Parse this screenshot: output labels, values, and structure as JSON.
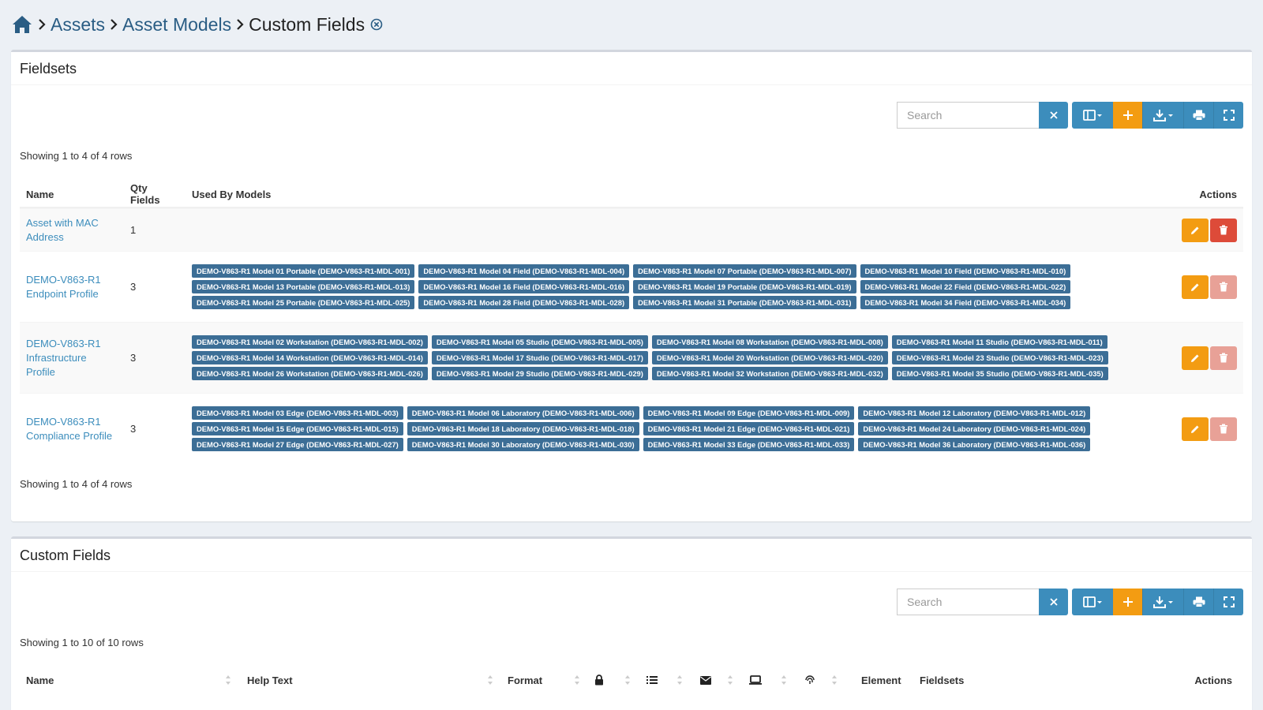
{
  "breadcrumb": {
    "items": [
      "Assets",
      "Asset Models"
    ],
    "current": "Custom Fields"
  },
  "fieldsets": {
    "title": "Fieldsets",
    "search_placeholder": "Search",
    "showing_top": "Showing 1 to 4 of 4 rows",
    "showing_bottom": "Showing 1 to 4 of 4 rows",
    "columns": [
      "Name",
      "Qty Fields",
      "Used By Models",
      "Actions"
    ],
    "rows": [
      {
        "name": "Asset with MAC Address",
        "qty": "1",
        "models": []
      },
      {
        "name": "DEMO-V863-R1 Endpoint Profile",
        "qty": "3",
        "models": [
          "DEMO-V863-R1 Model 01 Portable (DEMO-V863-R1-MDL-001)",
          "DEMO-V863-R1 Model 04 Field (DEMO-V863-R1-MDL-004)",
          "DEMO-V863-R1 Model 07 Portable (DEMO-V863-R1-MDL-007)",
          "DEMO-V863-R1 Model 10 Field (DEMO-V863-R1-MDL-010)",
          "DEMO-V863-R1 Model 13 Portable (DEMO-V863-R1-MDL-013)",
          "DEMO-V863-R1 Model 16 Field (DEMO-V863-R1-MDL-016)",
          "DEMO-V863-R1 Model 19 Portable (DEMO-V863-R1-MDL-019)",
          "DEMO-V863-R1 Model 22 Field (DEMO-V863-R1-MDL-022)",
          "DEMO-V863-R1 Model 25 Portable (DEMO-V863-R1-MDL-025)",
          "DEMO-V863-R1 Model 28 Field (DEMO-V863-R1-MDL-028)",
          "DEMO-V863-R1 Model 31 Portable (DEMO-V863-R1-MDL-031)",
          "DEMO-V863-R1 Model 34 Field (DEMO-V863-R1-MDL-034)"
        ]
      },
      {
        "name": "DEMO-V863-R1 Infrastructure Profile",
        "qty": "3",
        "models": [
          "DEMO-V863-R1 Model 02 Workstation (DEMO-V863-R1-MDL-002)",
          "DEMO-V863-R1 Model 05 Studio (DEMO-V863-R1-MDL-005)",
          "DEMO-V863-R1 Model 08 Workstation (DEMO-V863-R1-MDL-008)",
          "DEMO-V863-R1 Model 11 Studio (DEMO-V863-R1-MDL-011)",
          "DEMO-V863-R1 Model 14 Workstation (DEMO-V863-R1-MDL-014)",
          "DEMO-V863-R1 Model 17 Studio (DEMO-V863-R1-MDL-017)",
          "DEMO-V863-R1 Model 20 Workstation (DEMO-V863-R1-MDL-020)",
          "DEMO-V863-R1 Model 23 Studio (DEMO-V863-R1-MDL-023)",
          "DEMO-V863-R1 Model 26 Workstation (DEMO-V863-R1-MDL-026)",
          "DEMO-V863-R1 Model 29 Studio (DEMO-V863-R1-MDL-029)",
          "DEMO-V863-R1 Model 32 Workstation (DEMO-V863-R1-MDL-032)",
          "DEMO-V863-R1 Model 35 Studio (DEMO-V863-R1-MDL-035)"
        ]
      },
      {
        "name": "DEMO-V863-R1 Compliance Profile",
        "qty": "3",
        "models": [
          "DEMO-V863-R1 Model 03 Edge (DEMO-V863-R1-MDL-003)",
          "DEMO-V863-R1 Model 06 Laboratory (DEMO-V863-R1-MDL-006)",
          "DEMO-V863-R1 Model 09 Edge (DEMO-V863-R1-MDL-009)",
          "DEMO-V863-R1 Model 12 Laboratory (DEMO-V863-R1-MDL-012)",
          "DEMO-V863-R1 Model 15 Edge (DEMO-V863-R1-MDL-015)",
          "DEMO-V863-R1 Model 18 Laboratory (DEMO-V863-R1-MDL-018)",
          "DEMO-V863-R1 Model 21 Edge (DEMO-V863-R1-MDL-021)",
          "DEMO-V863-R1 Model 24 Laboratory (DEMO-V863-R1-MDL-024)",
          "DEMO-V863-R1 Model 27 Edge (DEMO-V863-R1-MDL-027)",
          "DEMO-V863-R1 Model 30 Laboratory (DEMO-V863-R1-MDL-030)",
          "DEMO-V863-R1 Model 33 Edge (DEMO-V863-R1-MDL-033)",
          "DEMO-V863-R1 Model 36 Laboratory (DEMO-V863-R1-MDL-036)"
        ]
      }
    ]
  },
  "custom_fields": {
    "title": "Custom Fields",
    "search_placeholder": "Search",
    "showing_top": "Showing 1 to 10 of 10 rows",
    "columns": {
      "name": "Name",
      "help_text": "Help Text",
      "format": "Format",
      "element": "Element",
      "fieldsets": "Fieldsets",
      "actions": "Actions"
    }
  },
  "icons": [
    "home-icon",
    "chevron-right-icon",
    "x-circle-icon",
    "close-icon",
    "columns-icon",
    "plus-icon",
    "download-icon",
    "print-icon",
    "fullscreen-icon",
    "pencil-icon",
    "trash-icon",
    "lock-icon",
    "list-icon",
    "envelope-icon",
    "laptop-icon",
    "fingerprint-icon"
  ],
  "colors": {
    "primary": "#3c8dbc",
    "warning": "#f39c12",
    "danger": "#dd4b39",
    "tag": "#3c6e96",
    "link": "#2a5d84"
  }
}
